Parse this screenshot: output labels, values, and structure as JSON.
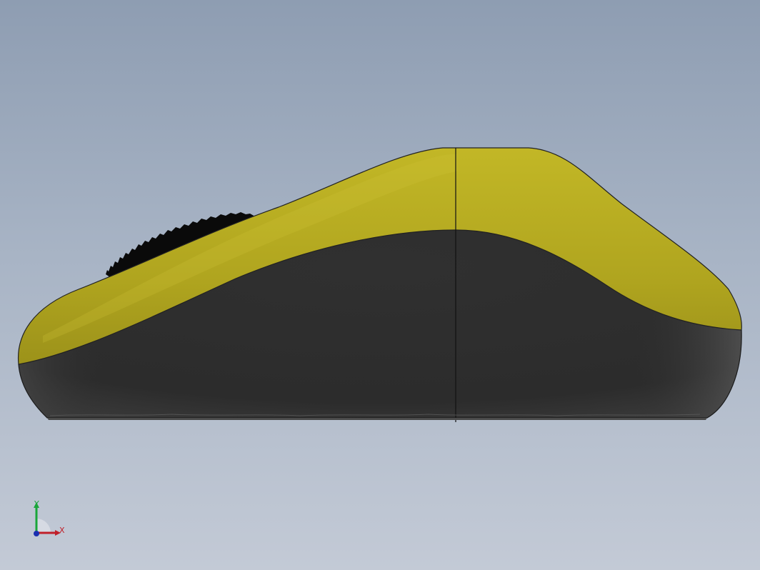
{
  "viewport": {
    "background_top": "#8e9db2",
    "background_bottom": "#c3cad6"
  },
  "model": {
    "name": "computer-mouse",
    "top_shell_color": "#b8ad22",
    "body_color": "#303030",
    "scroll_wheel_color": "#0a0a0a"
  },
  "triad": {
    "x_label": "X",
    "y_label": "Y",
    "x_color": "#c0202a",
    "y_color": "#1aa63a",
    "z_color": "#1a2fb0"
  }
}
